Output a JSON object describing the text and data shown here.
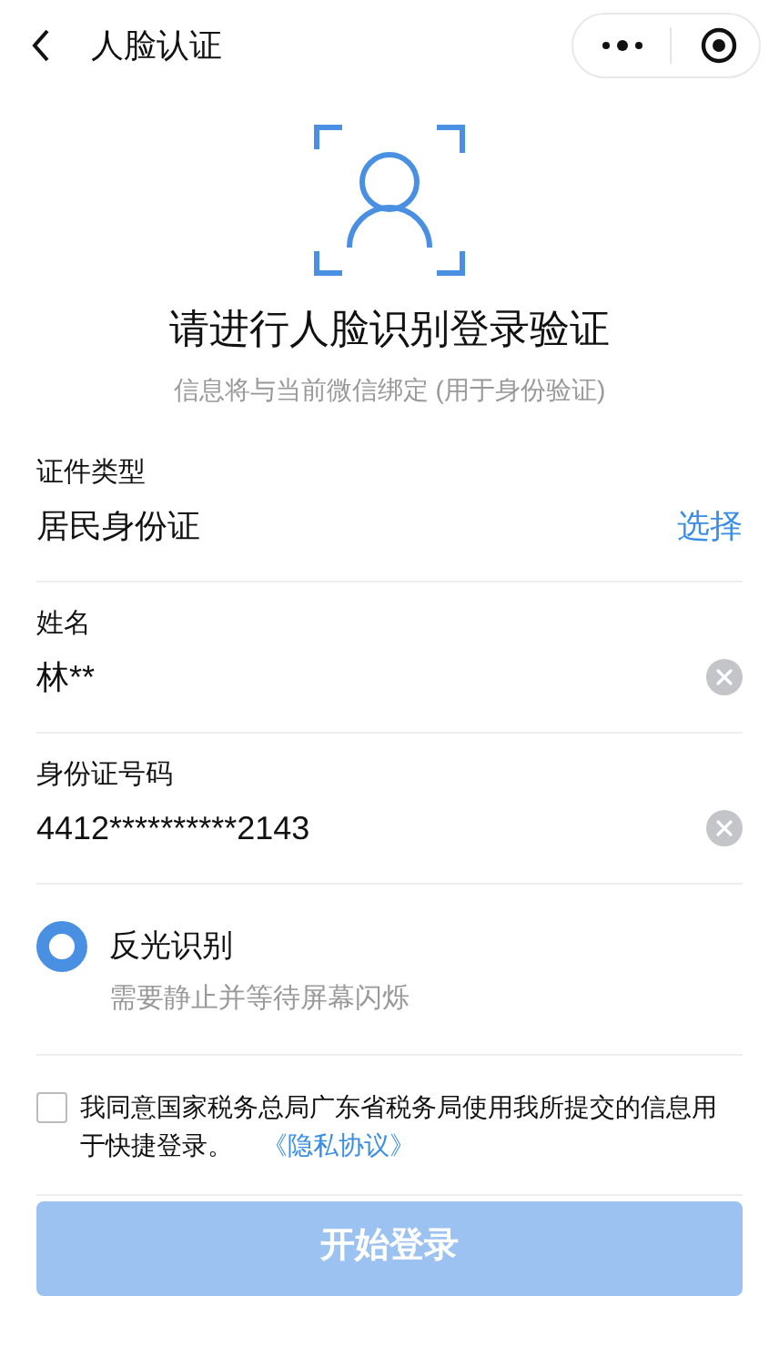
{
  "nav": {
    "title": "人脸认证"
  },
  "heading": "请进行人脸识别登录验证",
  "subheading": "信息将与当前微信绑定 (用于身份验证)",
  "fields": [
    {
      "kind": "select",
      "label": "证件类型",
      "value": "居民身份证",
      "action": "选择"
    },
    {
      "kind": "clearable",
      "label": "姓名",
      "value": "林**"
    },
    {
      "kind": "clearable",
      "label": "身份证号码",
      "value": "4412**********2143"
    }
  ],
  "mode": {
    "label": "反光识别",
    "hint": "需要静止并等待屏幕闪烁",
    "selected": true
  },
  "agreement": {
    "checked": false,
    "text": "我同意国家税务总局广东省税务局使用我所提交的信息用于快捷登录。",
    "link": "《隐私协议》"
  },
  "submit": {
    "label": "开始登录",
    "disabled": true
  }
}
